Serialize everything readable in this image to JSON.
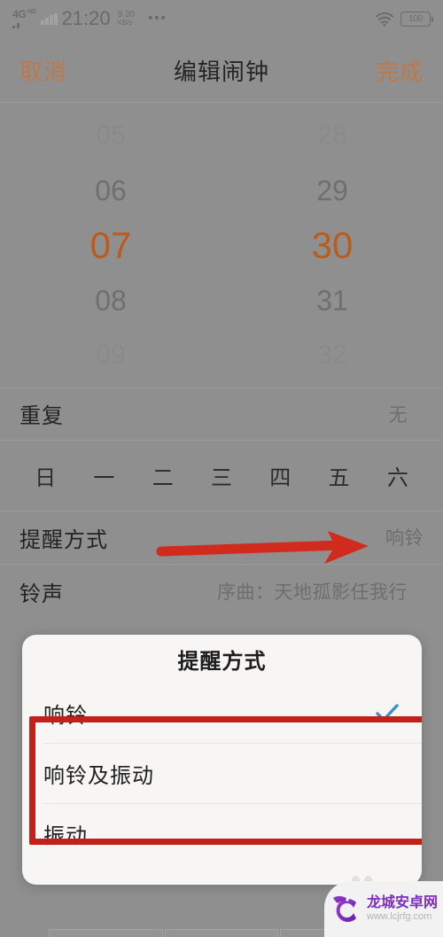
{
  "status_bar": {
    "network_type": "4G",
    "network_sub": "HD",
    "time": "21:20",
    "net_speed_value": "9.30",
    "net_speed_unit": "KB/s",
    "overflow_dots": "•••",
    "wifi_icon": "wifi-icon",
    "battery_level": "100"
  },
  "nav": {
    "cancel_label": "取消",
    "title": "编辑闹钟",
    "done_label": "完成",
    "accent_color": "#c0784a"
  },
  "time_picker": {
    "hours": [
      "05",
      "06",
      "07",
      "08",
      "09"
    ],
    "minutes": [
      "28",
      "29",
      "30",
      "31",
      "32"
    ],
    "selected_hour": "07",
    "selected_minute": "30",
    "selected_color": "#bb5c1e"
  },
  "rows": {
    "repeat": {
      "label": "重复",
      "value": "无"
    },
    "weekdays": [
      "日",
      "一",
      "二",
      "三",
      "四",
      "五",
      "六"
    ],
    "reminder_mode": {
      "label": "提醒方式",
      "value": "响铃"
    },
    "ringtone": {
      "label": "铃声",
      "value": "序曲：天地孤影任我行"
    }
  },
  "annotation": {
    "arrow_color": "#d12b1e",
    "highlight_box_color": "#c0221b"
  },
  "dialog": {
    "title": "提醒方式",
    "options": [
      {
        "label": "响铃",
        "checked": true
      },
      {
        "label": "响铃及振动",
        "checked": false
      },
      {
        "label": "振动",
        "checked": false
      }
    ],
    "check_color": "#3d8fd0"
  },
  "watermark": {
    "site_name": "龙城安卓网",
    "url": "www.lcjrfg.com",
    "brand_color": "#7b2fbe"
  }
}
